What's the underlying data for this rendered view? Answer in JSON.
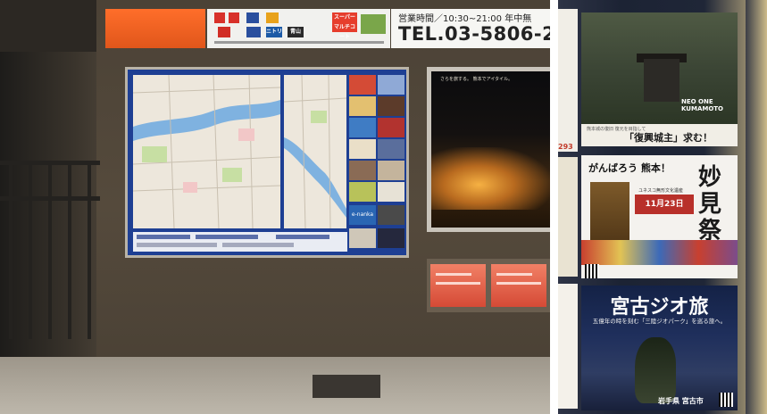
{
  "left_photo": {
    "store_sign": {
      "hours": "営業時間／10:30~21:00 年中無",
      "phone": "TEL.03-5806-2",
      "logos": [
        "スーパー マルチコート",
        "青山",
        "ニトリ"
      ]
    },
    "map_board": {
      "label_legend": "e-nanka"
    },
    "poster": {
      "caption": "さらを旅する。 熊本でアイタイル。"
    }
  },
  "right_photo": {
    "castle_poster": {
      "neo_one": "NEO ONE KUMAMOTO",
      "small": "熊本城の復旧 復元を目指して",
      "headline": "「復興城主」求む！",
      "left_number": "293"
    },
    "myoken_poster": {
      "headline": "がんばろう 熊本！",
      "title": "妙見祭",
      "date": "11月23日",
      "small": "ユネスコ無形文化遺産"
    },
    "miyako_poster": {
      "title": "宮古ジオ旅",
      "subtitle": "五億年の時を刻む「三陸ジオパーク」を巡る旅へ。",
      "footer": "岩手県 宮古市"
    }
  }
}
